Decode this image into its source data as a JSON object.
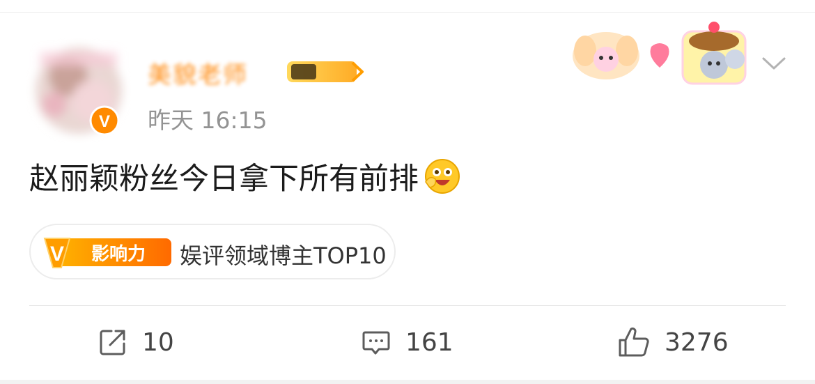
{
  "post": {
    "author_name": "美貌老师",
    "time": "昨天 16:15",
    "text": "赵丽颖粉丝今日拿下所有前排",
    "emoji": "laughing-emoji"
  },
  "tag": {
    "badge_text": "影响力",
    "label": "娱评领域博主TOP10"
  },
  "actions": {
    "repost_count": "10",
    "comment_count": "161",
    "like_count": "3276"
  },
  "icons": {
    "more": "chevron-down-icon",
    "repost": "share-icon",
    "comment": "comment-icon",
    "like": "thumbs-up-icon"
  },
  "colors": {
    "name": "#ff8200",
    "badge_orange": "#ff8a00",
    "text": "#1b1b1b",
    "meta": "#939393"
  }
}
